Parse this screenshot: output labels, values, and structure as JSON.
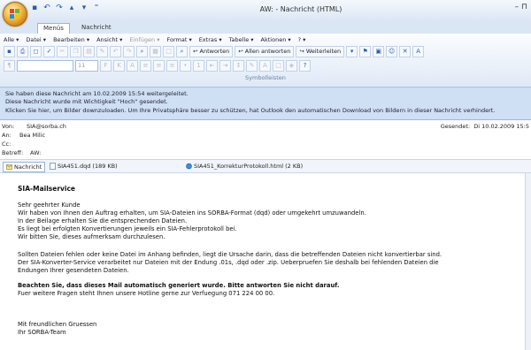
{
  "window": {
    "title": "AW: - Nachricht (HTML)",
    "controls": "– ⊓"
  },
  "tabs": [
    "Menüs",
    "Nachricht"
  ],
  "menu": {
    "items": [
      "Alle ▾",
      "Datei ▾",
      "Bearbeiten ▾",
      "Ansicht ▾",
      "Einfügen ▾",
      "Format ▾",
      "Extras ▾",
      "Tabelle ▾",
      "Aktionen ▾",
      "? ▾"
    ]
  },
  "toolbar": {
    "reply": "Antworten",
    "reply_all": "Allen antworten",
    "forward": "Weiterleiten",
    "font_placeholder": "",
    "font_size": "11",
    "group_label": "Symbolleisten"
  },
  "infobar": {
    "line1": "Sie haben diese Nachricht am 10.02.2009 15:54 weitergeleitet.",
    "line2": "Diese Nachricht wurde mit Wichtigkeit \"Hoch\" gesendet.",
    "line3": "Klicken Sie hier, um Bilder downzuloaden. Um Ihre Privatsphäre besser zu schützen, hat Outlook den automatischen Download von Bildern in dieser Nachricht verhindert."
  },
  "header": {
    "from_label": "Von:",
    "from_value": "SIA@sorba.ch",
    "to_label": "An:",
    "to_value": "Bea Milic",
    "cc_label": "Cc:",
    "cc_value": "",
    "subject_label": "Betreff:",
    "subject_value": "AW:",
    "sent_label": "Gesendet:",
    "sent_value": "Di 10.02.2009 15:5"
  },
  "attachments": {
    "message_tab": "Nachricht",
    "files": [
      "SIA451.dqd (189 KB)",
      "SIA451_KorrekturProtokoll.html (2 KB)"
    ]
  },
  "message": {
    "heading": "SIA-Mailservice",
    "greeting": "Sehr geehrter Kunde",
    "p1": [
      "Wir haben von Ihnen den Auftrag erhalten, um SIA-Dateien ins SORBA-Format (dqd) oder umgekehrt umzuwandeln.",
      "In der Beilage erhalten Sie die entsprechenden Dateien.",
      "Es liegt bei erfolgten Konvertierungen jeweils ein SIA-Fehlerprotokoll bei.",
      "Wir bitten Sie, dieses aufmerksam durchzulesen."
    ],
    "p2": [
      "Sollten Dateien fehlen oder keine Datei im Anhang befinden, liegt die Ursache darin, dass die betreffenden Dateien nicht konvertierbar sind.",
      "Der SIA-Konverter-Service verarbeitet nur Dateien mit der Endung .01s, .dqd oder .zip. Ueberpruefen Sie deshalb bei fehlenden Dateien die",
      "Endungen Ihrer gesendeten Dateien."
    ],
    "notice": "Beachten Sie, dass dieses Mail automatisch generiert wurde. Bitte antworten Sie nicht darauf.",
    "hotline": "Fuer weitere Fragen steht Ihnen unsere Hotline gerne zur Verfuegung 071 224 00 00.",
    "closing": "Mit freundlichen Gruessen",
    "signature": "Ihr SORBA-Team"
  }
}
